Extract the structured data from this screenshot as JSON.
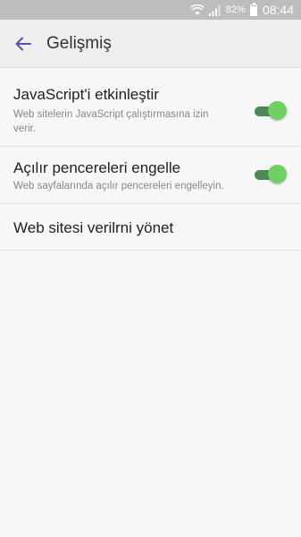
{
  "status_bar": {
    "battery_percent": "82%",
    "battery_level": 0.82,
    "time": "08:44",
    "icons": [
      "wifi-icon",
      "signal-icon",
      "battery-icon"
    ]
  },
  "app_bar": {
    "back_icon": "arrow-left-icon",
    "title": "Gelişmiş"
  },
  "settings": [
    {
      "title": "JavaScript'i etkinleştir",
      "subtitle": "Web sitelerin JavaScript çalıştırmasına izin verir.",
      "toggle_on": true
    },
    {
      "title": "Açılır pencereleri engelle",
      "subtitle": "Web sayfalarında açılır pencereleri engelleyin.",
      "toggle_on": true
    },
    {
      "title": "Web sitesi verilrni yönet"
    }
  ],
  "colors": {
    "accent": "#5a4fb3",
    "toggle_track": "#4f8a55",
    "toggle_thumb": "#6fd163"
  }
}
